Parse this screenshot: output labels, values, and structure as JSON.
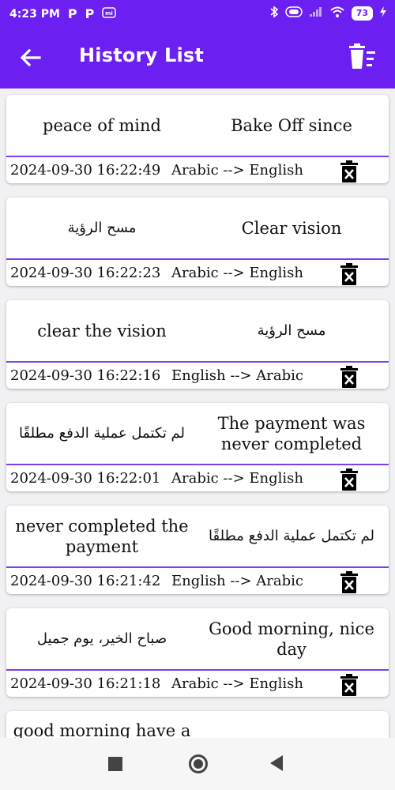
{
  "status_bar": {
    "time": "4:23 PM",
    "notification_icons": [
      "P",
      "P"
    ],
    "battery_level": "73"
  },
  "app_bar": {
    "title": "History List"
  },
  "history": [
    {
      "left": "peace of mind",
      "left_rtl": false,
      "right": "Bake Off since",
      "right_rtl": false,
      "timestamp": "2024-09-30 16:22:49",
      "direction": "Arabic --> English"
    },
    {
      "left": "مسح الرؤية",
      "left_rtl": true,
      "right": "Clear vision",
      "right_rtl": false,
      "timestamp": "2024-09-30 16:22:23",
      "direction": "Arabic --> English"
    },
    {
      "left": "clear the vision",
      "left_rtl": false,
      "right": "مسح الرؤية",
      "right_rtl": true,
      "timestamp": "2024-09-30 16:22:16",
      "direction": "English --> Arabic"
    },
    {
      "left": "لم تكتمل عملية الدفع مطلقًا",
      "left_rtl": true,
      "right": "The payment was never completed",
      "right_rtl": false,
      "timestamp": "2024-09-30 16:22:01",
      "direction": "Arabic --> English"
    },
    {
      "left": "never completed the payment",
      "left_rtl": false,
      "right": "لم تكتمل عملية الدفع مطلقًا",
      "right_rtl": true,
      "timestamp": "2024-09-30 16:21:42",
      "direction": "English --> Arabic"
    },
    {
      "left": "صباح الخير، يوم جميل",
      "left_rtl": true,
      "right": "Good morning, nice day",
      "right_rtl": false,
      "timestamp": "2024-09-30 16:21:18",
      "direction": "Arabic --> English"
    },
    {
      "left": "good morning have a",
      "left_rtl": false,
      "right": "",
      "right_rtl": false,
      "timestamp": "",
      "direction": ""
    }
  ],
  "icons": {
    "back": "arrow-left-icon",
    "delete_all": "delete-sweep-icon",
    "delete_item": "trash-icon"
  },
  "colors": {
    "primary": "#6b1ff0",
    "divider": "#7b3ff2"
  }
}
